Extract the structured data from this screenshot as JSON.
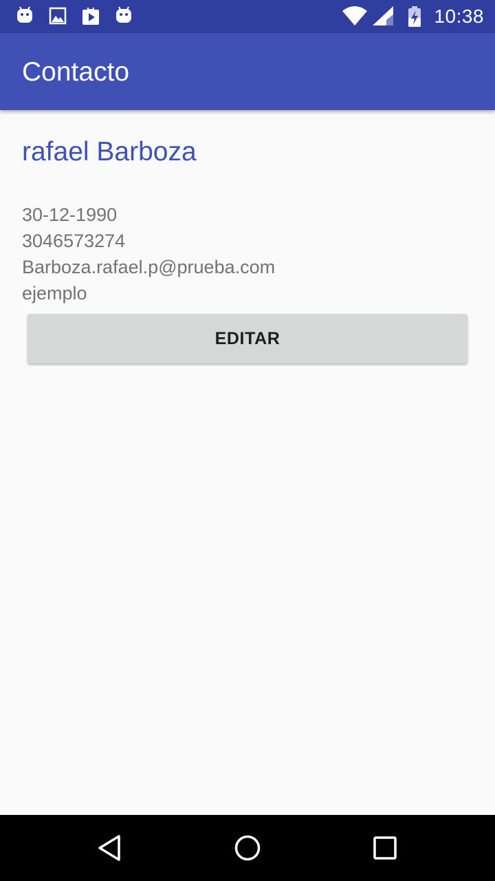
{
  "status_bar": {
    "time": "10:38",
    "notification_icons": [
      "android-icon",
      "image-icon",
      "play-store-icon",
      "android-icon"
    ],
    "system_icons": [
      "wifi-icon",
      "cellular-signal-icon",
      "battery-charging-icon"
    ]
  },
  "app_bar": {
    "title": "Contacto"
  },
  "contact": {
    "name": "rafael Barboza",
    "birth_date": "30-12-1990",
    "phone": "3046573274",
    "email": "Barboza.rafael.p@prueba.com",
    "description": "ejemplo"
  },
  "actions": {
    "edit_label": "EDITAR"
  },
  "nav_bar": {
    "buttons": [
      "back-icon",
      "home-icon",
      "recents-icon"
    ]
  },
  "colors": {
    "status_bar": "#303f9f",
    "app_bar": "#3f51b5",
    "accent_text": "#3f51b5",
    "secondary_text": "#737373",
    "button_bg": "#d6d7d7",
    "background": "#fafafa"
  }
}
